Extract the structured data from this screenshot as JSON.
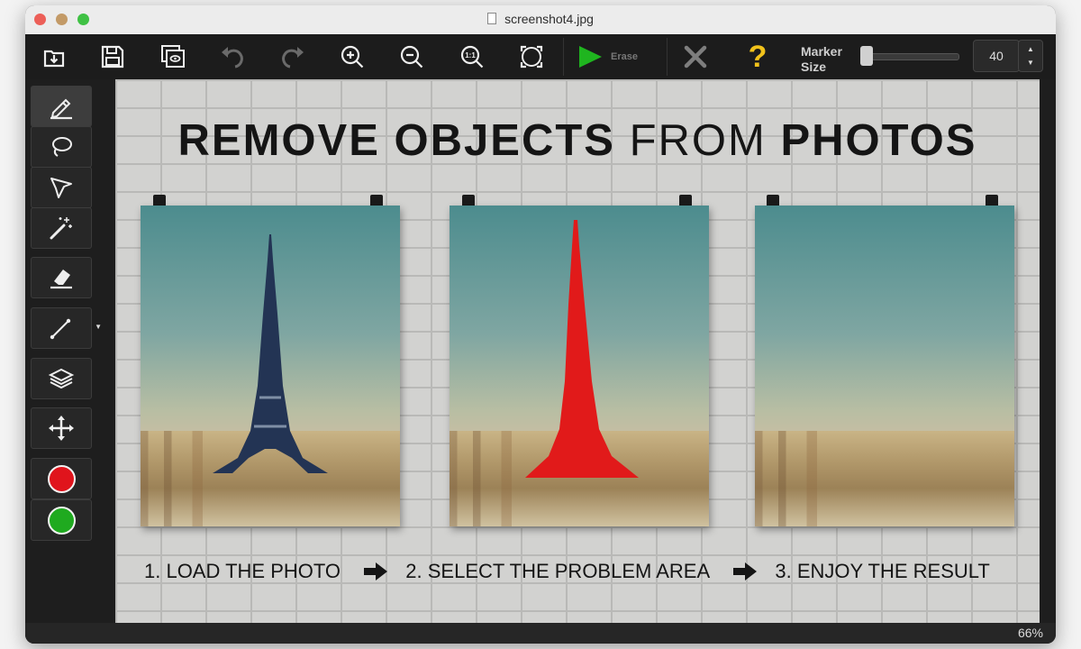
{
  "window": {
    "title": "screenshot4.jpg"
  },
  "toolbar": {
    "buttons": [
      {
        "name": "open-icon"
      },
      {
        "name": "save-icon"
      },
      {
        "name": "preview-icon"
      },
      {
        "name": "undo-icon"
      },
      {
        "name": "redo-icon"
      },
      {
        "name": "zoom-in-icon"
      },
      {
        "name": "zoom-out-icon"
      },
      {
        "name": "actual-size-icon",
        "label": "1:1"
      },
      {
        "name": "fit-screen-icon"
      }
    ],
    "erase_label": "Erase",
    "cancel_icon": "close-icon",
    "help_label": "?",
    "marker_size_label": "Marker Size",
    "marker_size_fraction": 0.0,
    "marker_size_value": "40",
    "stepper_up": "▲",
    "stepper_down": "▼"
  },
  "sidebar": {
    "tools": [
      {
        "name": "marker-tool",
        "icon": "pencil-icon",
        "active": true
      },
      {
        "name": "lasso-tool",
        "icon": "lasso-icon"
      },
      {
        "name": "polygon-lasso-tool",
        "icon": "polygon-lasso-icon"
      },
      {
        "name": "magic-wand-tool",
        "icon": "magic-wand-icon"
      },
      {
        "name": "eraser-tool",
        "icon": "eraser-icon"
      },
      {
        "name": "line-tool",
        "icon": "line-icon"
      },
      {
        "name": "layers-tool",
        "icon": "layers-icon"
      },
      {
        "name": "move-tool",
        "icon": "move-icon"
      }
    ],
    "colors": [
      "#e0141c",
      "#1faa1f"
    ]
  },
  "canvas": {
    "headline_bold_1": "REMOVE OBJECTS ",
    "headline_light": "FROM ",
    "headline_bold_2": "PHOTOS",
    "step1": "1. LOAD THE PHOTO",
    "step2": "2. SELECT THE PROBLEM AREA",
    "step3": "3. ENJOY THE RESULT",
    "selection_color": "#e11a1a"
  },
  "status": {
    "zoom": "66%"
  }
}
